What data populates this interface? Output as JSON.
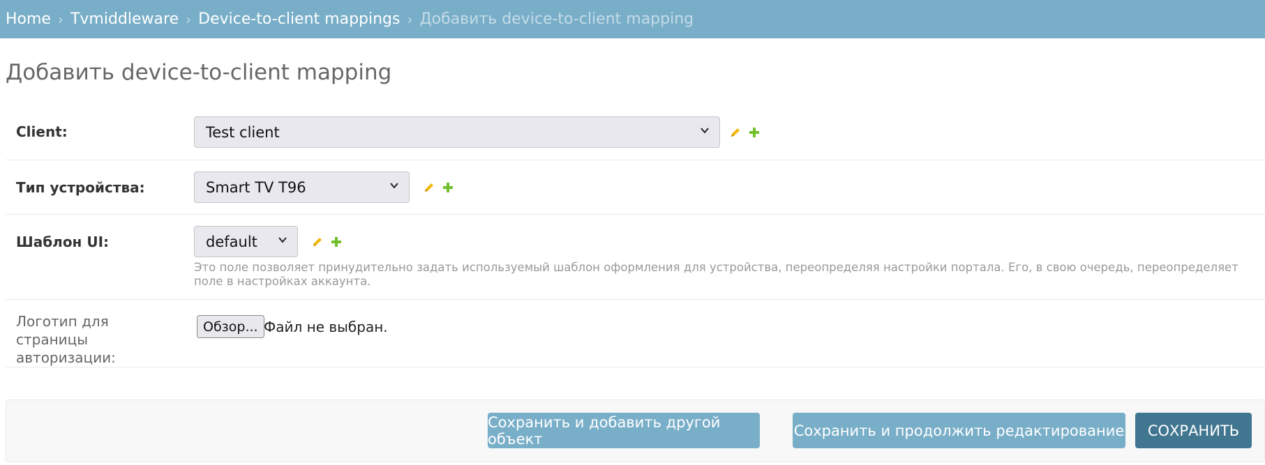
{
  "breadcrumbs": {
    "home": "Home",
    "app": "Tvmiddleware",
    "model": "Device-to-client mappings",
    "current": "Добавить device-to-client mapping",
    "separator": "›"
  },
  "page": {
    "title": "Добавить device-to-client mapping"
  },
  "form": {
    "client": {
      "label": "Client:",
      "value": "Test client"
    },
    "device_type": {
      "label": "Тип устройства:",
      "value": "Smart TV T96"
    },
    "ui_template": {
      "label": "Шаблон UI:",
      "value": "default",
      "help": "Это поле позволяет принудительно задать используемый шаблон оформления для устройства, переопределяя настройки портала. Его, в свою очередь, переопределяет поле в настройках аккаунта."
    },
    "logo": {
      "label": "Логотип для страницы авторизации:",
      "browse_label": "Обзор...",
      "status": "Файл не выбран."
    }
  },
  "actions": {
    "save_add_another": "Сохранить и добавить другой объект",
    "save_continue": "Сохранить и продолжить редактирование",
    "save": "СОХРАНИТЬ"
  },
  "icons": {
    "edit": "pencil-icon",
    "add": "plus-icon"
  },
  "colors": {
    "header": "#79aec8",
    "button": "#79aec8",
    "primary_button": "#417690",
    "edit_icon": "#efb80b",
    "add_icon": "#70bf2b"
  }
}
